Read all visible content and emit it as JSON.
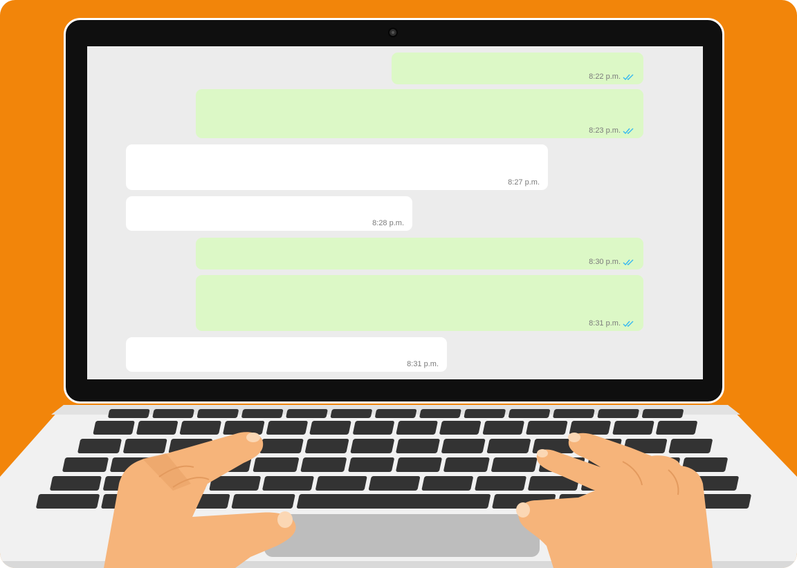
{
  "colors": {
    "background": "#f2850a",
    "outgoing_bubble": "#dcf8c6",
    "incoming_bubble": "#ffffff",
    "screen": "#ececec",
    "read_ticks": "#34b7f1",
    "key": "#333333",
    "skin": "#f6b47a"
  },
  "chat": {
    "messages": [
      {
        "direction": "outgoing",
        "time": "8:22 p.m.",
        "status": "read",
        "status_icon": "double-check-icon"
      },
      {
        "direction": "outgoing",
        "time": "8:23 p.m.",
        "status": "read",
        "status_icon": "double-check-icon"
      },
      {
        "direction": "incoming",
        "time": "8:27 p.m."
      },
      {
        "direction": "incoming",
        "time": "8:28 p.m."
      },
      {
        "direction": "outgoing",
        "time": "8:30 p.m.",
        "status": "read",
        "status_icon": "double-check-icon"
      },
      {
        "direction": "outgoing",
        "time": "8:31 p.m.",
        "status": "read",
        "status_icon": "double-check-icon"
      },
      {
        "direction": "incoming",
        "time": "8:31 p.m."
      }
    ]
  }
}
